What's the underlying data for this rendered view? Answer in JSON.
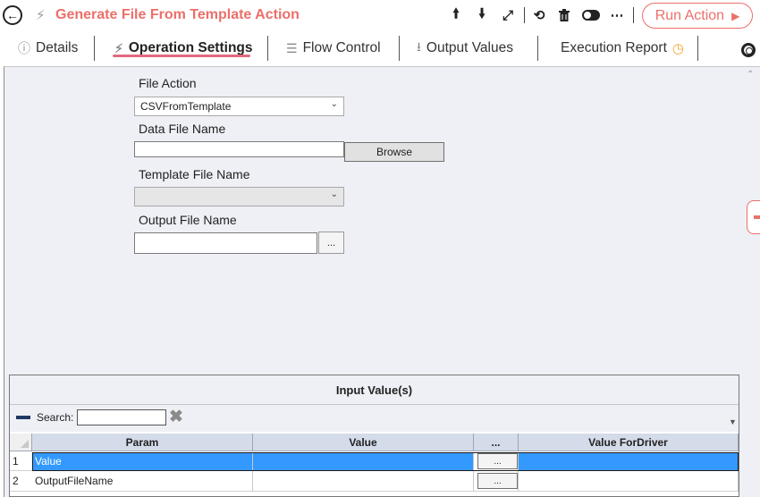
{
  "header": {
    "back_icon": "back-arrow-circle-icon",
    "title": "Generate File From Template Action",
    "toolbar_icons": [
      "arrow-up-icon",
      "arrow-down-icon",
      "expand-icon",
      "undo-icon",
      "trash-icon",
      "toggle-icon",
      "more-icon"
    ],
    "run_label": "Run Action",
    "brand_color": "#ec6f6a"
  },
  "tabs": {
    "details": "Details",
    "operation_settings": "Operation Settings",
    "flow_control": "Flow Control",
    "output_values": "Output Values",
    "execution_report": "Execution Report",
    "active": "Operation Settings"
  },
  "form": {
    "file_action_label": "File Action",
    "file_action_value": "CSVFromTemplate",
    "data_file_label": "Data File Name",
    "data_file_value": "",
    "browse_label": "Browse",
    "template_label": "Template File Name",
    "template_value": "",
    "output_label": "Output File Name",
    "output_value": "",
    "output_button_label": "..."
  },
  "grid": {
    "title": "Input Value(s)",
    "search_label": "Search:",
    "search_value": "",
    "columns": [
      "Param",
      "Value",
      "...",
      "Value ForDriver"
    ],
    "rows": [
      {
        "num": "1",
        "param": "Value",
        "value": "",
        "button": "...",
        "value_for_driver": "",
        "selected": true
      },
      {
        "num": "2",
        "param": "OutputFileName",
        "value": "",
        "button": "...",
        "value_for_driver": "",
        "selected": false
      }
    ]
  },
  "colors": {
    "selection": "#3399ff",
    "panel_background": "#eef0f5",
    "active_tab_underline": "#e06a80"
  }
}
